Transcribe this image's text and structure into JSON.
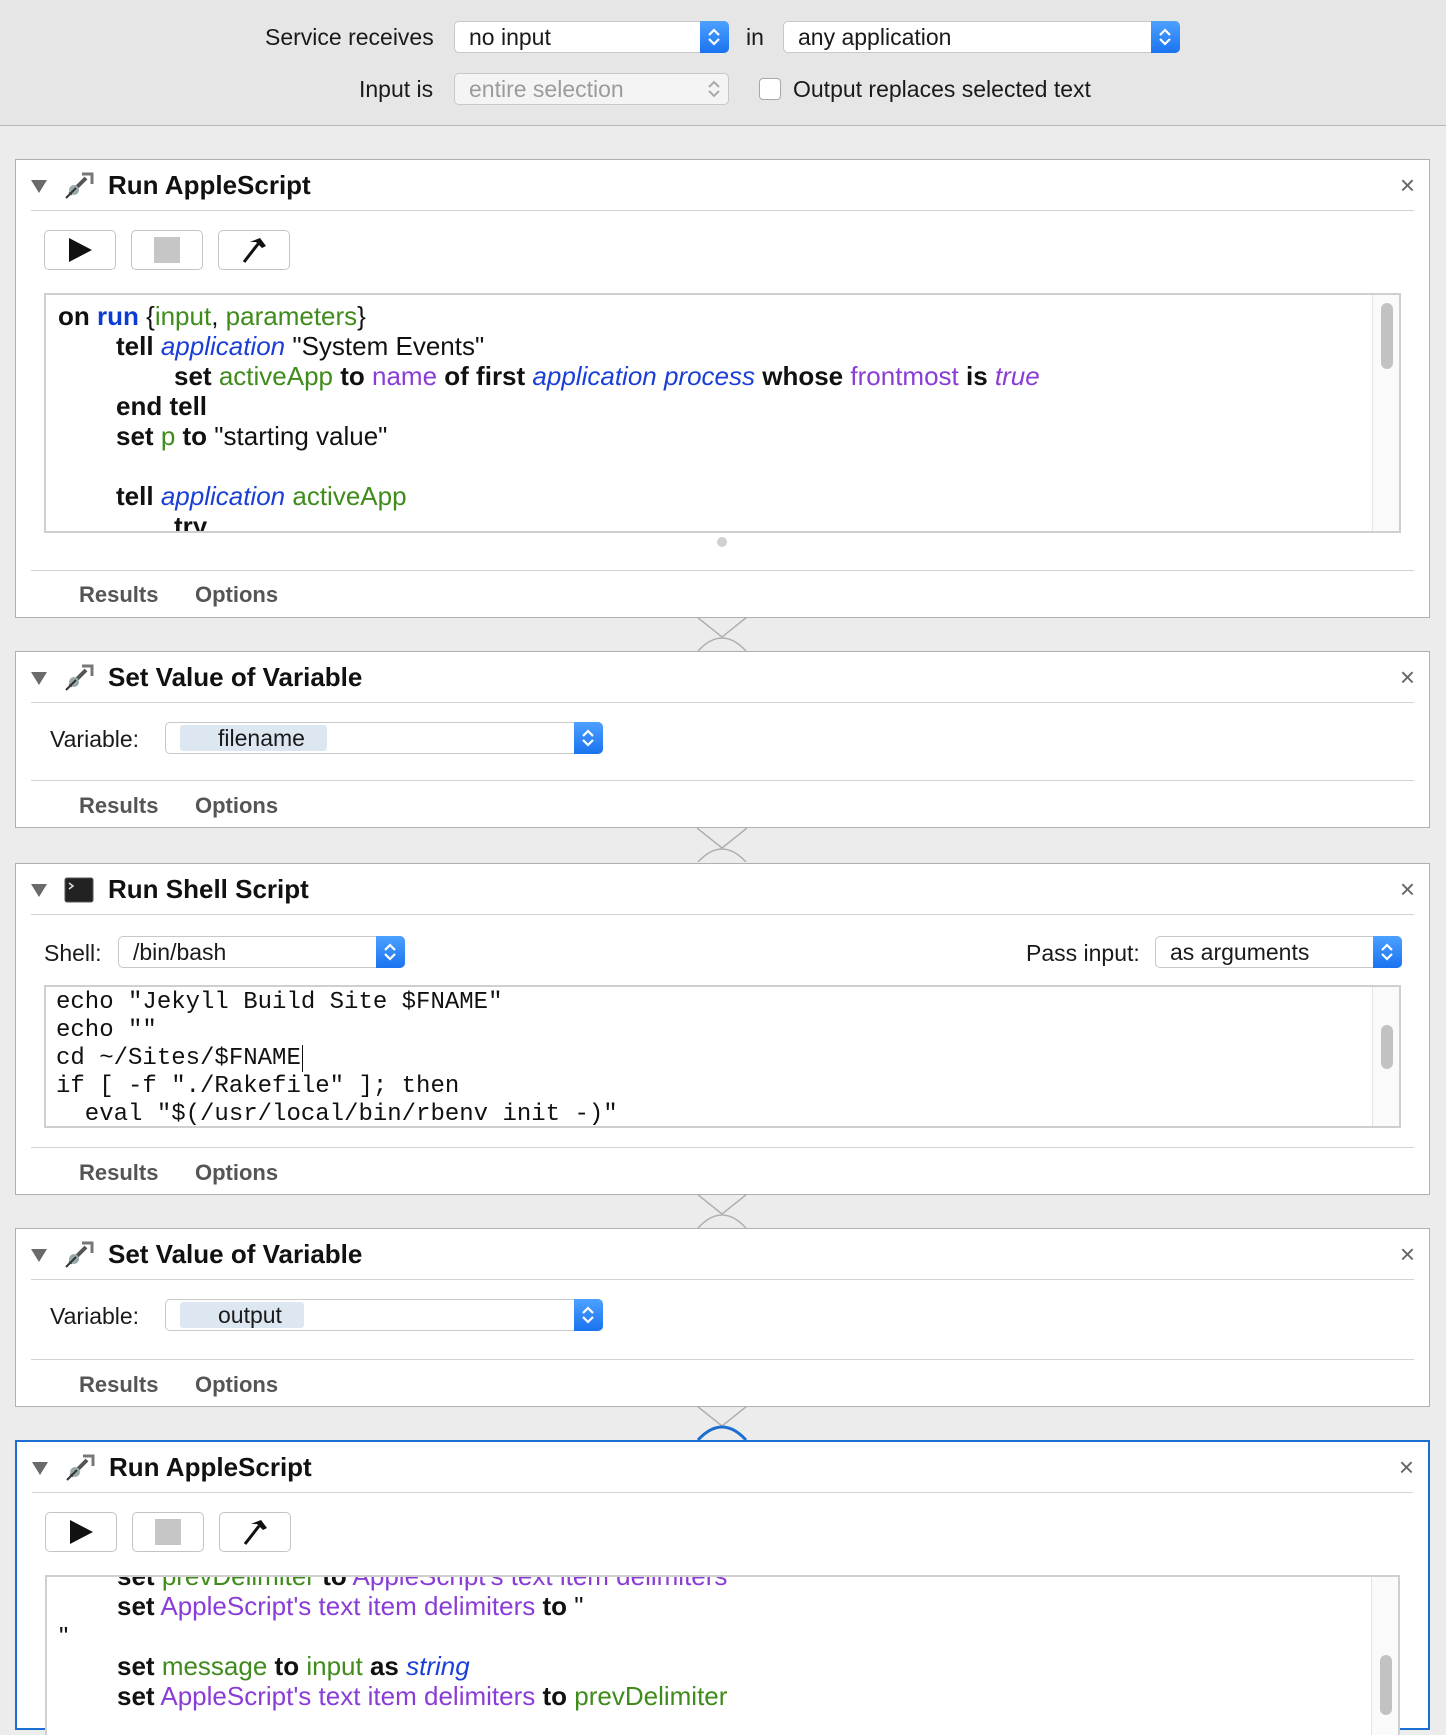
{
  "header": {
    "service_receives_label": "Service receives",
    "service_receives_value": "no input",
    "in_label": "in",
    "application_value": "any application",
    "input_is_label": "Input is",
    "input_is_value": "entire selection",
    "output_replaces_label": "Output replaces selected text",
    "output_replaces_checked": false
  },
  "actions": [
    {
      "title": "Run AppleScript",
      "icon": "applescript-icon",
      "close": "×",
      "tabs": [
        "Results",
        "Options"
      ],
      "code_lines": [
        "on run {input, parameters}",
        "tell application \"System Events\"",
        "set activeApp to name of first application process whose frontmost is true",
        "end tell",
        "set p to \"starting value\"",
        "",
        "tell application activeApp",
        "try"
      ]
    },
    {
      "title": "Set Value of Variable",
      "icon": "automator-icon",
      "close": "×",
      "variable_label": "Variable:",
      "variable_value": "filename",
      "tabs": [
        "Results",
        "Options"
      ]
    },
    {
      "title": "Run Shell Script",
      "icon": "terminal-icon",
      "close": "×",
      "shell_label": "Shell:",
      "shell_value": "/bin/bash",
      "pass_input_label": "Pass input:",
      "pass_input_value": "as arguments",
      "tabs": [
        "Results",
        "Options"
      ],
      "code_lines": [
        "echo \"Jekyll Build Site $FNAME\"",
        "echo \"\"",
        "cd ~/Sites/$FNAME",
        "if [ -f \"./Rakefile\" ]; then",
        "  eval \"$(/usr/local/bin/rbenv init -)\""
      ]
    },
    {
      "title": "Set Value of Variable",
      "icon": "automator-icon",
      "close": "×",
      "variable_label": "Variable:",
      "variable_value": "output",
      "tabs": [
        "Results",
        "Options"
      ]
    },
    {
      "title": "Run AppleScript",
      "icon": "applescript-icon",
      "close": "×",
      "code_lines": [
        "set prevDelimiter to AppleScript's text item delimiters",
        "set AppleScript's text item delimiters to \"",
        "\"",
        "set message to input as string",
        "set AppleScript's text item delimiters to prevDelimiter"
      ]
    }
  ]
}
